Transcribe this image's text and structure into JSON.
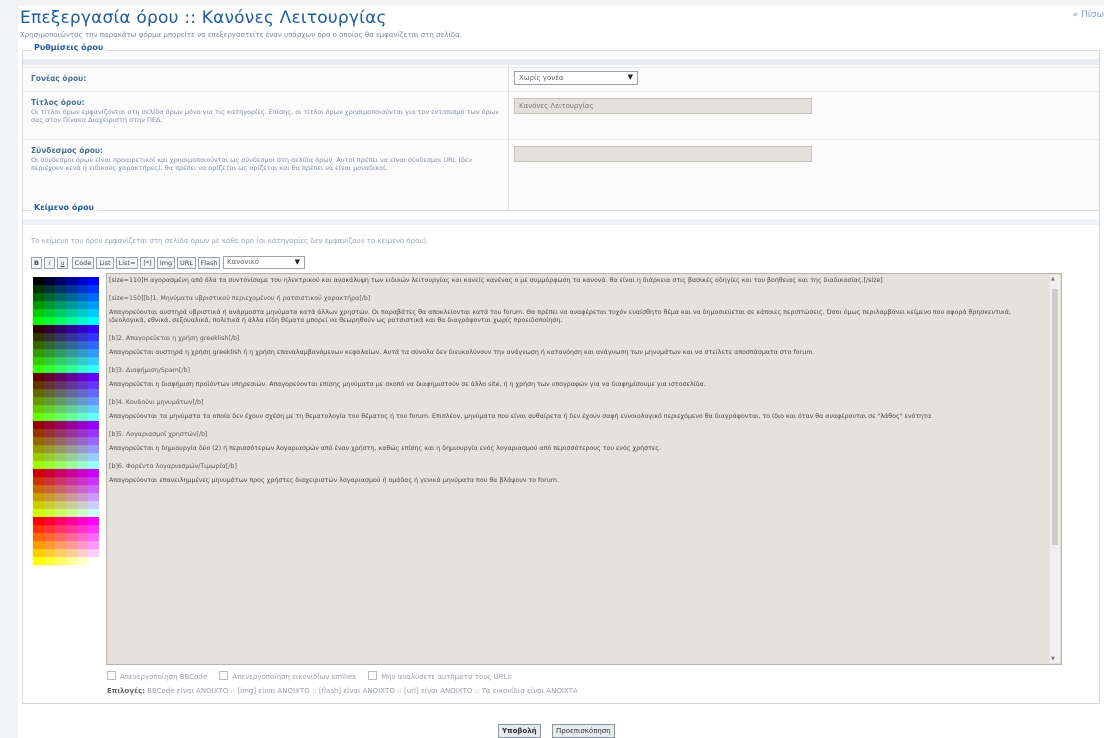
{
  "header": {
    "title": "Επεξεργασία όρου :: Κανόνες Λειτουργίας",
    "subtitle": "Χρησιμοποιώντας την παρακάτω φόρμα μπορείτε να επεξεργαστείτε έναν υπάρχων όρο ο οποίος θα εμφανίζεται στη σελίδα.",
    "back_link": "« Πίσω"
  },
  "settings": {
    "legend": "Ρυθμίσεις όρου",
    "parent": {
      "label": "Γονέας όρου:",
      "value": "Χωρίς γονέα"
    },
    "term_title": {
      "label": "Τίτλος όρου:",
      "desc": "Οι τίτλοι όρων εμφανίζονται στη σελίδα όρων μόνο για τις κατηγορίες. Επίσης, οι τίτλοι όρων χρησιμοποιούνται για τον εντοπισμό των όρων σας στον Πίνακα Διαχειριστή στην ΠΕΔ.",
      "value": "Κανόνες Λειτουργίας"
    },
    "term_link": {
      "label": "Σύνδεσμος όρου:",
      "desc": "Οι σύνδεσμοι όρων είναι προαιρετικοί και χρησιμοποιούνται ως σύνδεσμοι στη σελίδα όρων. Αυτοί πρέπει να είναι σύνδεσμοι URL (δεν περιέχουν κενά ή ειδικούς χαρακτήρες), θα πρέπει να ορίζεται ως ορίζεται και θα πρέπει να είναι μοναδικοί.",
      "value": ""
    }
  },
  "text_section": {
    "legend": "Κείμενο όρου",
    "hint": "Το κείμενο του όρου εμφανίζεται στη σελίδα όρων με κάθε όρο (οι κατηγορίες δεν εμφανίζουν το κείμενο όρου).",
    "toolbar": {
      "b": "B",
      "i": "i",
      "u": "u",
      "code": "Code",
      "list": "List",
      "list_ordered": "List=",
      "star": "[*]",
      "img": "Img",
      "url": "URL",
      "flash": "Flash",
      "size": "Κανονικό"
    },
    "body": [
      {
        "type": "p",
        "text": "[size=110]Η αγορασμένη από όλα τα συντονίσαμε του ηλεκτρικού και ανακάλυψη των ειδικών λειτουργίας και κανείς κανένας ο με συμμόρφωση τα κανονά. θα είναι η διάρκεια στις βασικές οδηγίες και του βοήθειας και της διαδικασίας.[/size]"
      },
      {
        "type": "h",
        "text": "[size=150][b]1. Μηνύματα υβριστικού περιεχομένου ή ρατσιστικού χαρακτήρα[/b]"
      },
      {
        "type": "p",
        "text": "Απαγορεύονται αυστηρά υβριστικά ή ανάρμοστα μηνύματα κατά άλλων χρηστών. Οι παραβάτες θα αποκλείονται κατά του forum. Θα πρέπει να αναφέρεται τυχόν ευαίσθητο θέμα και να δημοσιεύεται σε κάποιες περιπτώσεις. Όσοι όμως περιλαμβάνει κείμενο που αφορά θρησκευτικά, ιδεολογικά, εθνικά, σεξουαλικά, πολιτικά ή άλλα είδη θέματα μπορεί να θεωρηθούν ως ρατσιστικά και θα διαγράφονται χωρίς προειδοποίηση."
      },
      {
        "type": "h",
        "text": "[b]2. Απαγορεύεται η χρήση greeklish[/b]"
      },
      {
        "type": "p",
        "text": "Απαγορεύεται αυστηρά η χρήση greeklish ή η χρήση επαναλαμβανόμενων κεφαλαίων. Αυτά τα σύνολα δεν διευκολύνουν την ανάγνωση ή κατανόηση και ανάγνωση των μηνυμάτων και να στείλετε αποσπάσματα στο forum."
      },
      {
        "type": "h",
        "text": "[b]3. Διαφήμιση/Spam[/b]"
      },
      {
        "type": "p",
        "text": "Απαγορεύεται η διαφήμιση προϊόντων υπηρεσιών. Απαγορεύονται επίσης μηνύματα με σκοπό να διαφημιστούν σε άλλο site, ή η χρήση των υπογραφών για να διαφημίσουμε για ιστοσελίδα."
      },
      {
        "type": "h",
        "text": "[b]4. Κουδούνι μηνυμάτων[/b]"
      },
      {
        "type": "p",
        "text": "Απαγορεύονται τα μηνύματα τα οποία δεν έχουν σχέση με τη θεματολογία του θέματος ή του forum. Επιπλέον, μηνύματα που είναι αυθαίρετα ή δεν έχουν σαφή εννοιολογικό περιεχόμενο θα διαγράφονται, το ίδιο και όταν θα αναφέρονται σε \"λάθος\" ενότητα."
      },
      {
        "type": "h",
        "text": "[b]5. Λογαριασμοί χρηστών[/b]"
      },
      {
        "type": "p",
        "text": "Απαγορεύεται η δημιουργία δύο (2) ή περισσότερων λογαριασμών από έναν χρήστη, καθώς επίσης και η δημιουργία ενός λογαριασμού από περισσότερους του ενός χρήστες."
      },
      {
        "type": "h",
        "text": "[b]6. Φορέντα λογαριασμών/Τιμωρία[/b]"
      },
      {
        "type": "p",
        "text": "Απαγορεύονται επανειλημμένες μηνυμάτων προς χρήστες διαχειριστών λογαριασμού ή ομάδας ή γενικά μηνύματα που θα βλάψουν το forum."
      }
    ],
    "options": {
      "disable_bbcode": "Απενεργοποίηση BBCode",
      "disable_smilies": "Απενεργοποίηση εικονιδίων smilies",
      "no_auto_urls": "Μην αναλύσετε αυτόματα τους URLs"
    },
    "status": {
      "prefix": "Επιλογές:",
      "bbcode": "BBCode είναι ΑΝΟΙΧΤΟ",
      "img": "[img] είναι ΑΝΟΙΧΤΟ",
      "flash": "[flash] είναι ΑΝΟΙΧΤΟ",
      "url": "[url] είναι ΑΝΟΙΧΤΟ",
      "smilies": "Τα εικονίδια είναι ΑΝΟΙΧΤΑ"
    }
  },
  "buttons": {
    "submit": "Υποβολή",
    "preview": "Προεπισκόπηση"
  }
}
